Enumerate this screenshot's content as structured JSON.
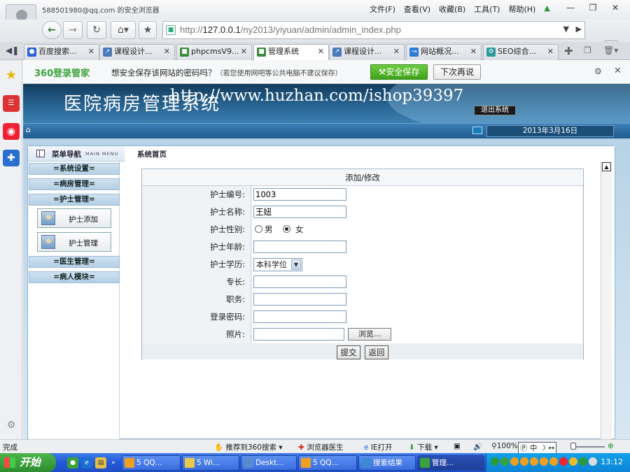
{
  "browser": {
    "account": "588501980@qq.com 的安全浏览器",
    "menus": [
      "文件(F)",
      "查看(V)",
      "收藏(B)",
      "工具(T)",
      "帮助(H)"
    ],
    "url_prefix": "http://",
    "url_host": "127.0.0.1",
    "url_path": "/ny2013/yiyuan/admin/admin_index.php",
    "tabs": [
      {
        "label": "百度搜索...",
        "icon": "paw-icon",
        "color": "#2a63d4"
      },
      {
        "label": "课程设计...",
        "icon": "doc-icon",
        "color": "#4a7ab8"
      },
      {
        "label": "phpcmsV9...",
        "icon": "page-icon",
        "color": "#3a8a3a"
      },
      {
        "label": "管理系统",
        "icon": "page-icon",
        "color": "#3a8a3a",
        "active": true
      },
      {
        "label": "课程设计...",
        "icon": "doc-icon",
        "color": "#4a7ab8"
      },
      {
        "label": "网站概况...",
        "icon": "chart-icon",
        "color": "#2b7cd6"
      },
      {
        "label": "SEO综合...",
        "icon": "seo-icon",
        "color": "#2a9a9a"
      }
    ]
  },
  "password_bar": {
    "logo": "360登录管家",
    "message": "想安全保存该网站的密码吗？",
    "note": "（若您使用网吧等公共电脑不建议保存）",
    "save_label": "安全保存",
    "later_label": "下次再说"
  },
  "app": {
    "title": "医院病房管理系统",
    "watermark": "http://www.huzhan.com/ishop39397",
    "logout_label": "退出系统",
    "date": "2013年3月16日",
    "nav_title": "菜单导航",
    "nav_sub": "MAIN MENU",
    "breadcrumb": "系统首页",
    "nav_groups": [
      "=系统设置=",
      "=病房管理=",
      "=护士管理=",
      "=医生管理=",
      "=病人模块="
    ],
    "nav_subitems": [
      "护士添加",
      "护士管理"
    ]
  },
  "form": {
    "heading": "添加/修改",
    "fields": {
      "id_label": "护士编号:",
      "id_value": "1003",
      "name_label": "护士名称:",
      "name_value": "王妞",
      "gender_label": "护士性别:",
      "gender_male": "男",
      "gender_female": "女",
      "gender_selected": "女",
      "age_label": "护士年龄:",
      "age_value": "",
      "edu_label": "护士学历:",
      "edu_value": "本科学位",
      "major_label": "专长:",
      "major_value": "",
      "job_label": "职务:",
      "job_value": "",
      "pwd_label": "登录密码:",
      "pwd_value": "",
      "photo_label": "照片:",
      "photo_value": "",
      "browse_label": "浏览..."
    },
    "submit_label": "提交",
    "back_label": "返回"
  },
  "statusbar": {
    "status": "完成",
    "recommend": "推荐到360搜索",
    "doctor": "浏览器医生",
    "ie_open": "IE打开",
    "download": "下载",
    "zoom": "100%",
    "ime": "中"
  },
  "taskbar": {
    "start_label": "开始",
    "items": [
      {
        "label": "5 QQ...",
        "color": "#f0a020"
      },
      {
        "label": "5 Wi...",
        "color": "#e8c84a"
      },
      {
        "label": "Deskt...",
        "color": "#5a8ad0"
      },
      {
        "label": "5 QQ...",
        "color": "#f0a020"
      },
      {
        "label": "搜索结果",
        "color": "#3a8ad6"
      },
      {
        "label": "管理...",
        "color": "#3aa23a"
      }
    ],
    "clock": "13:12"
  }
}
